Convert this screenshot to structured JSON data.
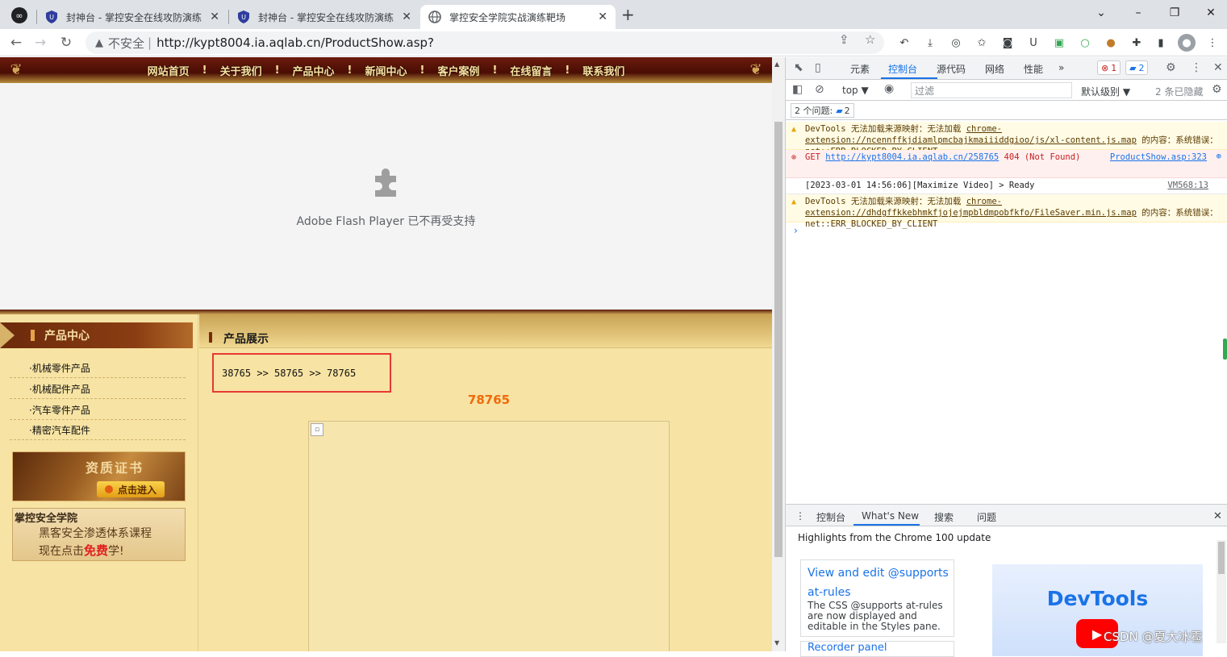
{
  "browser": {
    "tabs": [
      {
        "title": "封神台 - 掌控安全在线攻防演练",
        "active": false
      },
      {
        "title": "封神台 - 掌控安全在线攻防演练",
        "active": false
      },
      {
        "title": "掌控安全学院实战演练靶场",
        "active": true
      }
    ],
    "new_tab": "+",
    "window_controls": {
      "dropdown": "⌄",
      "minimize": "–",
      "maximize": "❐",
      "close": "✕"
    },
    "tab_close": "✕",
    "url_security": "不安全",
    "url_separator": "|",
    "url": "http://kypt8004.ia.aqlab.cn/ProductShow.asp?"
  },
  "site": {
    "nav": [
      "网站首页",
      "关于我们",
      "产品中心",
      "新闻中心",
      "客户案例",
      "在线留言",
      "联系我们"
    ],
    "nav_sep": "!",
    "flash_message": "Adobe Flash Player 已不再受支持",
    "sidebar_title": "产品中心",
    "categories": [
      "·机械零件产品",
      "·机械配件产品",
      "·汽车零件产品",
      "·精密汽车配件"
    ],
    "cert_title": "资质证书",
    "cert_button": "点击进入",
    "school_name": "掌控安全学院",
    "school_line1": "黑客安全渗透体系课程",
    "school_line2_pre": "现在点击",
    "school_line2_free": "免费",
    "school_line2_post": "学!",
    "main_title": "产品展示",
    "breadcrumb": "38765 >> 58765 >> 78765",
    "product_name": "78765"
  },
  "devtools": {
    "tabs": [
      "元素",
      "控制台",
      "源代码",
      "网络",
      "性能"
    ],
    "more": "»",
    "error_count": "1",
    "issue_count": "2",
    "context": "top ▼",
    "filter_placeholder": "过滤",
    "level": "默认级别 ▼",
    "hidden": "2 条已隐藏",
    "issues_label": "2 个问题:",
    "issues_badge": "2",
    "messages": [
      {
        "level": "warn",
        "pre": "DevTools 无法加载来源映射：无法加载 ",
        "link": "chrome-extension://ncennffkjdiamlpmcbajkmaiiiddgioo/js/xl-content.js.map",
        "post": " 的内容：系统错误：net::ERR_BLOCKED_BY_CLIENT"
      },
      {
        "level": "error",
        "pre": "GET ",
        "link": "http://kypt8004.ia.aqlab.cn/258765",
        "post": " 404 (Not Found)",
        "source": "ProductShow.asp:323"
      },
      {
        "level": "info",
        "pre": "[2023-03-01 14:56:06][Maximize Video] > Ready",
        "source": "VM568:13"
      },
      {
        "level": "warn",
        "pre": "DevTools 无法加载来源映射：无法加载 ",
        "link": "chrome-extension://dhdgffkkebhmkfjojejmpbldmpobfkfo/FileSaver.min.js.map",
        "post": " 的内容：系统错误：net::ERR_BLOCKED_BY_CLIENT"
      }
    ],
    "prompt": "›",
    "drawer_tabs": [
      "控制台",
      "What's New",
      "搜索",
      "问题"
    ],
    "highlights": "Highlights from the Chrome 100 update",
    "card_title": "View and edit @supports at-rules",
    "card_desc": "The CSS @supports at-rules are now displayed and editable in the Styles pane.",
    "card2_title": "Recorder panel",
    "promo_title": "DevTools",
    "watermark": "CSDN @夏大冰雹"
  }
}
